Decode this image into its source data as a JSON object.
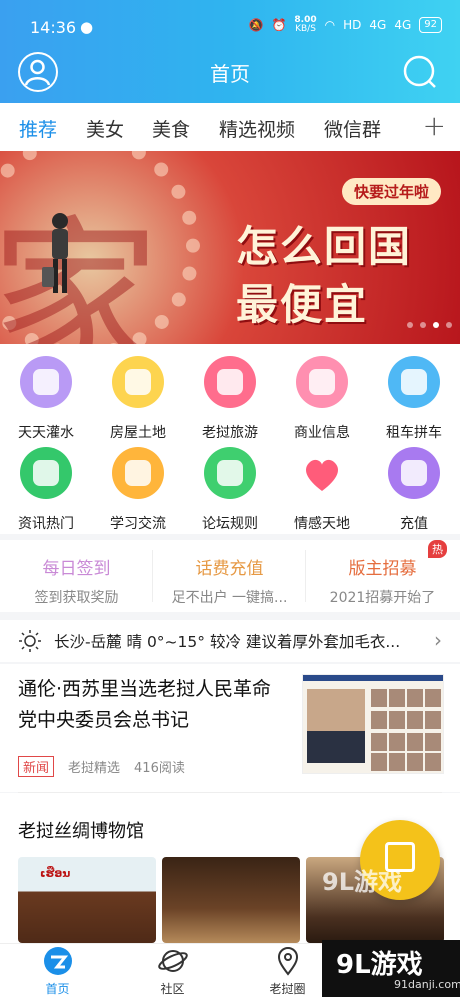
{
  "status": {
    "time": "14:36",
    "wechat_icon": "wechat-icon",
    "net_speed": "8.00",
    "net_unit": "KB/S",
    "hd": "HD",
    "sig1": "4G",
    "sig2": "4G",
    "battery": "92"
  },
  "header": {
    "title": "首页"
  },
  "tabs": [
    {
      "label": "推荐"
    },
    {
      "label": "美女"
    },
    {
      "label": "美食"
    },
    {
      "label": "精选视频"
    },
    {
      "label": "微信群"
    }
  ],
  "tabs_plus": "+",
  "banner": {
    "tag": "快要过年啦",
    "line1": "怎么回国",
    "line2": "最便宜",
    "big_char": "家"
  },
  "grid": [
    {
      "label": "天天灌水",
      "color": "#b99af5"
    },
    {
      "label": "房屋土地",
      "color": "#fdd44f"
    },
    {
      "label": "老挝旅游",
      "color": "#ff6d8d"
    },
    {
      "label": "商业信息",
      "color": "#ff8fb0"
    },
    {
      "label": "租车拼车",
      "color": "#4fb8f5"
    },
    {
      "label": "资讯热门",
      "color": "#34c86b"
    },
    {
      "label": "学习交流",
      "color": "#ffb53b"
    },
    {
      "label": "论坛规则",
      "color": "#3fcf6f"
    },
    {
      "label": "情感天地",
      "color": "#ff5c7a"
    },
    {
      "label": "充值",
      "color": "#a87af0"
    }
  ],
  "cards": [
    {
      "title": "每日签到",
      "sub": "签到获取奖励",
      "color": "#c98ad6"
    },
    {
      "title": "话费充值",
      "sub": "足不出户 一键搞...",
      "color": "#e69944"
    },
    {
      "title": "版主招募",
      "sub": "2021招募开始了",
      "color": "#e56d3e"
    }
  ],
  "cards_hot": "热",
  "weather": {
    "text": "长沙-岳麓 晴 0°~15° 较冷 建议着厚外套加毛衣...",
    "chevron": "›"
  },
  "news": {
    "title": "通伦·西苏里当选老挝人民革命党中央委员会总书记",
    "badge": "新闻",
    "source": "老挝精选",
    "reads": "416阅读"
  },
  "section": {
    "title": "老挝丝绸博物馆",
    "pic1_label": "ເຮືອນ"
  },
  "tabbar": [
    {
      "label": "首页"
    },
    {
      "label": "社区"
    },
    {
      "label": "老挝圈"
    }
  ],
  "watermark": {
    "big": "9L游戏",
    "small": "91danji.com",
    "overlay": "9L游戏"
  }
}
